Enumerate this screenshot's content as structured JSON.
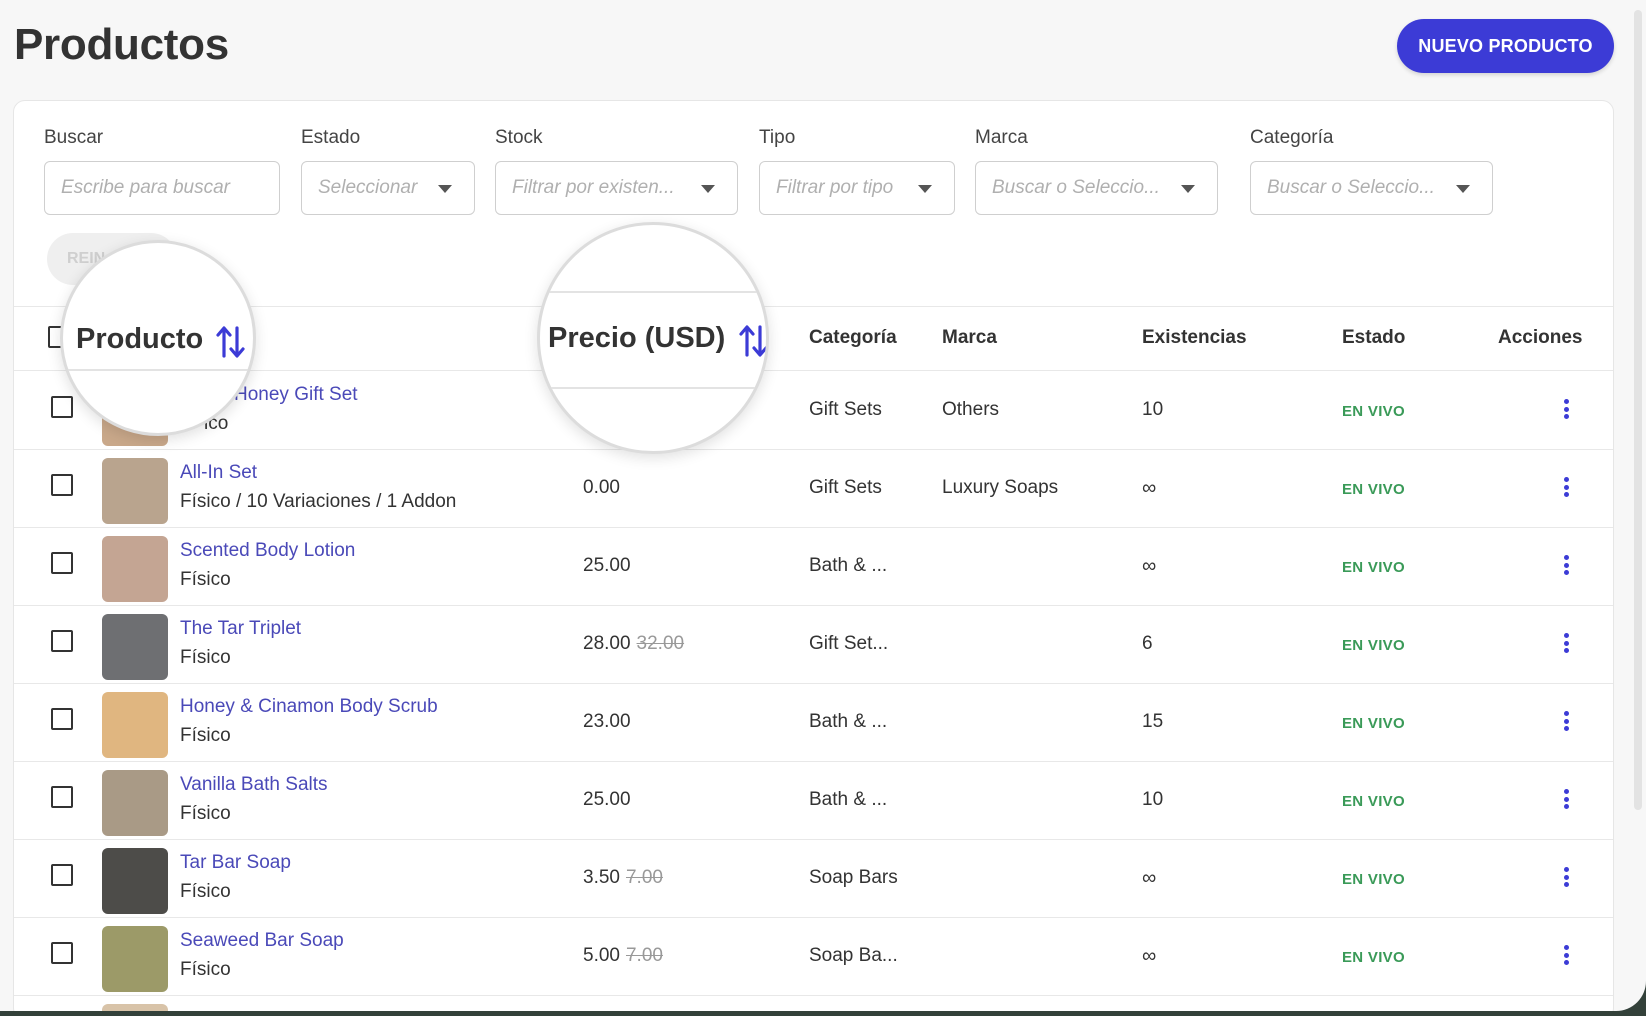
{
  "header": {
    "title": "Productos",
    "new_button": "NUEVO PRODUCTO"
  },
  "filters": [
    {
      "label": "Buscar",
      "placeholder": "Escribe para buscar"
    },
    {
      "label": "Estado",
      "placeholder": "Seleccionar"
    },
    {
      "label": "Stock",
      "placeholder": "Filtrar por existen..."
    },
    {
      "label": "Tipo",
      "placeholder": "Filtrar por tipo"
    },
    {
      "label": "Marca",
      "placeholder": "Buscar o Seleccio..."
    },
    {
      "label": "Categoría",
      "placeholder": "Buscar o Seleccio..."
    }
  ],
  "reset_button": "REIN",
  "columns": {
    "producto": "Producto",
    "precio": "Precio (USD)",
    "categoria": "Categoría",
    "marca": "Marca",
    "existencias": "Existencias",
    "estado": "Estado",
    "acciones": "Acciones"
  },
  "rows": [
    {
      "name": "Honey Gift Set",
      "type": "ico",
      "price": "",
      "old_price": "",
      "category": "Gift Sets",
      "brand": "Others",
      "stock": "10",
      "status": "EN VIVO",
      "thumb_color": "#c9a88a"
    },
    {
      "name": "All-In Set",
      "type": "Físico / 10 Variaciones / 1 Addon",
      "price": "0.00",
      "old_price": "",
      "category": "Gift Sets",
      "brand": "Luxury Soaps",
      "stock": "∞",
      "status": "EN VIVO",
      "thumb_color": "#b9a48e"
    },
    {
      "name": "Scented Body Lotion",
      "type": "Físico",
      "price": "25.00",
      "old_price": "",
      "category": "Bath & ...",
      "brand": "",
      "stock": "∞",
      "status": "EN VIVO",
      "thumb_color": "#c4a593"
    },
    {
      "name": "The Tar Triplet",
      "type": "Físico",
      "price": "28.00",
      "old_price": "32.00",
      "category": "Gift Set...",
      "brand": "",
      "stock": "6",
      "status": "EN VIVO",
      "thumb_color": "#6e6f72"
    },
    {
      "name": "Honey & Cinamon Body Scrub",
      "type": "Físico",
      "price": "23.00",
      "old_price": "",
      "category": "Bath & ...",
      "brand": "",
      "stock": "15",
      "status": "EN VIVO",
      "thumb_color": "#e0b680"
    },
    {
      "name": "Vanilla Bath Salts",
      "type": "Físico",
      "price": "25.00",
      "old_price": "",
      "category": "Bath & ...",
      "brand": "",
      "stock": "10",
      "status": "EN VIVO",
      "thumb_color": "#a99a86"
    },
    {
      "name": "Tar Bar Soap",
      "type": "Físico",
      "price": "3.50",
      "old_price": "7.00",
      "category": "Soap Bars",
      "brand": "",
      "stock": "∞",
      "status": "EN VIVO",
      "thumb_color": "#4d4c49"
    },
    {
      "name": "Seaweed Bar Soap",
      "type": "Físico",
      "price": "5.00",
      "old_price": "7.00",
      "category": "Soap Ba...",
      "brand": "",
      "stock": "∞",
      "status": "EN VIVO",
      "thumb_color": "#9c9a68"
    }
  ],
  "colors": {
    "accent": "#3c3bd6",
    "live": "#3a9a58",
    "link": "#4a49b8"
  },
  "icons": {
    "sort": "sort-arrows-icon",
    "actions": "kebab-menu-icon"
  }
}
